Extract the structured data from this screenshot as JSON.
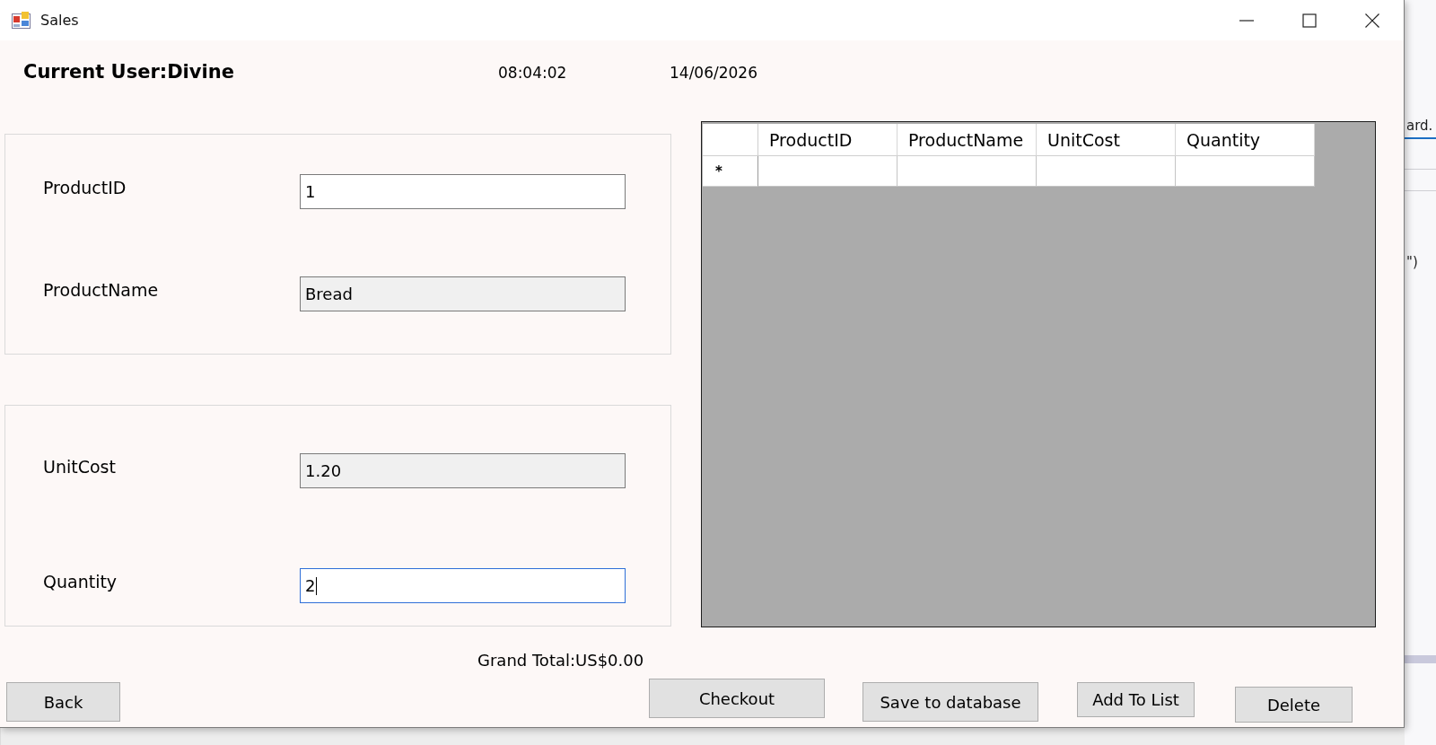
{
  "window": {
    "title": "Sales"
  },
  "header": {
    "current_user": "Current User:Divine",
    "time": "08:04:02",
    "date": "14/06/2026"
  },
  "product_group": {
    "fields": [
      {
        "label": "ProductID",
        "value": "1",
        "readonly": false,
        "focused": false
      },
      {
        "label": "ProductName",
        "value": "Bread",
        "readonly": true,
        "focused": false
      }
    ]
  },
  "cost_group": {
    "fields": [
      {
        "label": "UnitCost",
        "value": "1.20",
        "readonly": true,
        "focused": false
      },
      {
        "label": "Quantity",
        "value": "2",
        "readonly": false,
        "focused": true
      }
    ]
  },
  "grid": {
    "columns": [
      "ProductID",
      "ProductName",
      "UnitCost",
      "Quantity"
    ],
    "new_row": {
      "marker": "*"
    }
  },
  "grand_total": "Grand Total:US$0.00",
  "buttons": [
    "Back",
    "Checkout",
    "Save to database",
    "Add To List",
    "Delete"
  ],
  "background_window": {
    "tab": "ard.",
    "code": "\")"
  }
}
